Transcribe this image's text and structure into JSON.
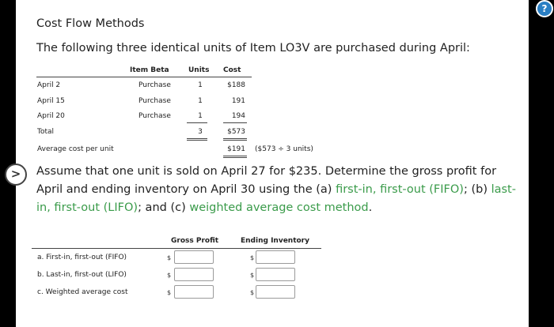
{
  "title": "Cost Flow Methods",
  "intro": "The following three identical units of Item LO3V are purchased during April:",
  "purchase_table": {
    "headers": [
      "Item Beta",
      "Units",
      "Cost"
    ],
    "rows": [
      {
        "date": "April 2",
        "item": "Purchase",
        "units": "1",
        "cost": "$188"
      },
      {
        "date": "April 15",
        "item": "Purchase",
        "units": "1",
        "cost": "191"
      },
      {
        "date": "April 20",
        "item": "Purchase",
        "units": "1",
        "cost": "194"
      }
    ],
    "total": {
      "label": "Total",
      "units": "3",
      "cost": "$573"
    },
    "average": {
      "label": "Average cost per unit",
      "cost": "$191",
      "note": "($573 ÷ 3 units)"
    }
  },
  "question": {
    "part1": "Assume that one unit is sold on April 27 for $235. Determine the gross profit for April and ending inventory on April 30 using the (a) ",
    "fifo": "first-in, first-out (FIFO)",
    "part2": "; (b) ",
    "lifo": "last-in, first-out (LIFO)",
    "part3": "; and (c) ",
    "weighted": "weighted average cost method",
    "part4": "."
  },
  "answer_table": {
    "headers": [
      "Gross Profit",
      "Ending Inventory"
    ],
    "currency": "$",
    "rows": [
      {
        "label": "a. First-in, first-out (FIFO)",
        "gross_profit": "",
        "ending_inventory": ""
      },
      {
        "label": "b. Last-in, first-out (LIFO)",
        "gross_profit": "",
        "ending_inventory": ""
      },
      {
        "label": "c. Weighted average cost",
        "gross_profit": "",
        "ending_inventory": ""
      }
    ]
  },
  "help_icon": "help-icon",
  "expand_icon": "chevron-right-icon",
  "colors": {
    "link_green": "#3a9b4a",
    "help_blue": "#2a7fc4"
  }
}
